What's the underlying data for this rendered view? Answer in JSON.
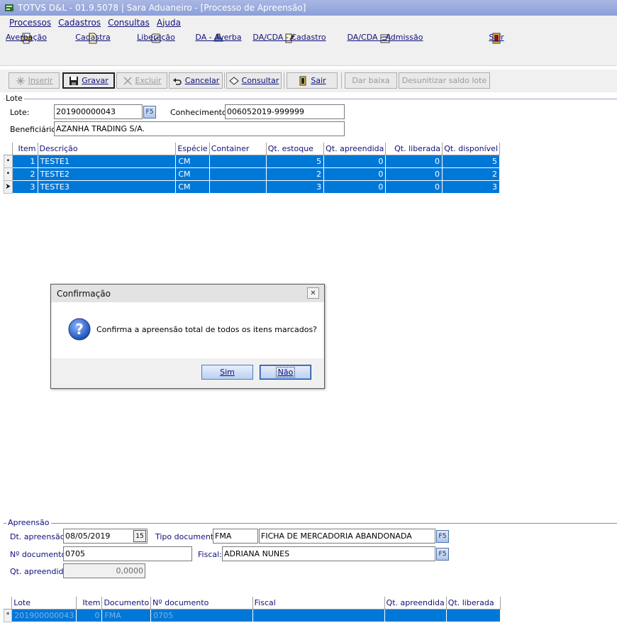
{
  "window": {
    "title": "TOTVS D&L - 01.9.5078 | Sara Aduaneiro - [Processo de Apreensão]"
  },
  "menu": [
    "Processos",
    "Cadastros",
    "Consultas",
    "Ajuda"
  ],
  "bigtoolbar": [
    {
      "label": "Averbação",
      "icon": "printer-icon"
    },
    {
      "label": "Cadastra",
      "icon": "document-icon"
    },
    {
      "label": "Liberação",
      "icon": "release-icon"
    },
    {
      "label": "DA - Averba",
      "icon": "stamp-icon"
    },
    {
      "label": "DA/CDA - Cadastro",
      "icon": "edit-doc-icon"
    },
    {
      "label": "DA/CDA - Admissão",
      "icon": "admission-icon"
    },
    {
      "label": "Sair",
      "icon": "exit-door-icon"
    }
  ],
  "toolbar": {
    "inserir": "Inserir",
    "gravar": "Gravar",
    "excluir": "Excluir",
    "cancelar": "Cancelar",
    "consultar": "Consultar",
    "sair": "Sair",
    "dar_baixa": "Dar baixa",
    "desunitizar": "Desunitizar saldo lote"
  },
  "lote": {
    "group_title": "Lote",
    "lote_label": "Lote:",
    "lote_value": "201900000043",
    "f5": "F5",
    "conhecimento_label": "Conhecimento:",
    "conhecimento_value": "006052019-999999",
    "beneficiario_label": "Beneficiário:",
    "beneficiario_value": "AZANHA TRADING S/A."
  },
  "items_grid": {
    "columns": [
      "Item",
      "Descrição",
      "Espécie",
      "Container",
      "Qt. estoque",
      "Qt. apreendida",
      "Qt. liberada",
      "Qt. disponível"
    ],
    "rows": [
      {
        "indicator": "•",
        "item": "1",
        "descricao": "TESTE1",
        "especie": "CM",
        "container": "",
        "qt_estoque": "5",
        "qt_apreendida": "0",
        "qt_liberada": "0",
        "qt_disponivel": "5"
      },
      {
        "indicator": "•",
        "item": "2",
        "descricao": "TESTE2",
        "especie": "CM",
        "container": "",
        "qt_estoque": "2",
        "qt_apreendida": "0",
        "qt_liberada": "0",
        "qt_disponivel": "2"
      },
      {
        "indicator": "⮞",
        "item": "3",
        "descricao": "TESTE3",
        "especie": "CM",
        "container": "",
        "qt_estoque": "3",
        "qt_apreendida": "0",
        "qt_liberada": "0",
        "qt_disponivel": "3"
      }
    ]
  },
  "dialog": {
    "title": "Confirmação",
    "close": "✕",
    "message": "Confirma a apreensão total de todos os itens marcados?",
    "yes": "Sim",
    "no": "Não"
  },
  "apreensao": {
    "group_title": "Apreensão",
    "dt_label": "Dt. apreensão:",
    "dt_value": "08/05/2019",
    "cal": "15",
    "tipo_label": "Tipo documento:",
    "tipo_code": "FMA",
    "tipo_desc": "FICHA DE MERCADORIA ABANDONADA",
    "f5": "F5",
    "ndoc_label": "Nº documento:",
    "ndoc_value": "0705",
    "fiscal_label": "Fiscal:",
    "fiscal_value": "ADRIANA NUNES",
    "qt_label": "Qt. apreendida:",
    "qt_value": "0,0000"
  },
  "bottom_grid": {
    "columns": [
      "Lote",
      "Item",
      "Documento",
      "Nº documento",
      "Fiscal",
      "Qt. apreendida",
      "Qt. liberada"
    ],
    "row": {
      "indicator": "*",
      "lote": "201900000043",
      "item": "0",
      "documento": "FMA",
      "ndoc": "0705",
      "fiscal": "",
      "qt_apreendida": "",
      "qt_liberada": ""
    }
  },
  "colors": {
    "selection": "#0078d7",
    "titlebar": "#99aadd",
    "link": "#10107a"
  }
}
